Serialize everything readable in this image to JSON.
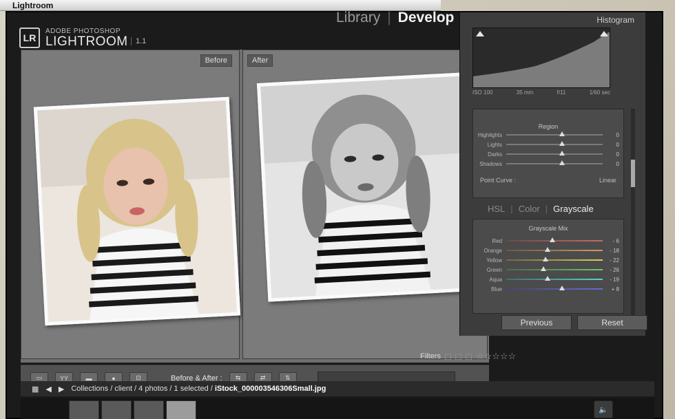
{
  "mac_menubar": {
    "app_name": "Lightroom"
  },
  "header": {
    "logo_mark": "LR",
    "brand_top": "ADOBE PHOTOSHOP",
    "brand_main": "LIGHTROOM",
    "version": "1.1",
    "modules": [
      {
        "label": "Library",
        "active": false
      },
      {
        "label": "Develop",
        "active": true
      }
    ]
  },
  "viewer": {
    "before_label": "Before",
    "after_label": "After"
  },
  "toolbar": {
    "before_after_label": "Before & After :",
    "view_buttons": [
      "loupe-view",
      "before-after-view",
      "compare",
      "spot",
      "crop"
    ],
    "filters_label": "Filters"
  },
  "right_panel": {
    "histogram_title": "Histogram",
    "histogram_meta": [
      "ISO 100",
      "35 mm",
      "f/11",
      "1/60 sec"
    ],
    "tone_section_title": "Region",
    "tone_sliders": [
      {
        "label": "Highlights",
        "value": 0,
        "position": 0.55
      },
      {
        "label": "Lights",
        "value": 0,
        "position": 0.55
      },
      {
        "label": "Darks",
        "value": 0,
        "position": 0.55
      },
      {
        "label": "Shadows",
        "value": 0,
        "position": 0.55
      }
    ],
    "point_curve_label": "Point Curve :",
    "point_curve_value": "Linear",
    "hsl_tabs": [
      "HSL",
      "Color",
      "Grayscale"
    ],
    "hsl_active": "Grayscale",
    "gray_mix_title": "Grayscale Mix",
    "gray_mix": [
      {
        "label": "Red",
        "value": "- 6",
        "position": 0.45
      },
      {
        "label": "Orange",
        "value": "- 18",
        "position": 0.4
      },
      {
        "label": "Yellow",
        "value": "- 22",
        "position": 0.38
      },
      {
        "label": "Green",
        "value": "- 26",
        "position": 0.36
      },
      {
        "label": "Aqua",
        "value": "- 19",
        "position": 0.4
      },
      {
        "label": "Blue",
        "value": "+ 8",
        "position": 0.55
      }
    ],
    "previous_button": "Previous",
    "reset_button": "Reset"
  },
  "breadcrumb": {
    "path": "Collections / client / 4 photos / 1 selected / ",
    "filename": "iStock_000003546306Small.jpg"
  },
  "filmstrip": {
    "thumbnails": [
      {
        "name": "thumb-1",
        "selected": false
      },
      {
        "name": "thumb-2",
        "selected": false
      },
      {
        "name": "thumb-3",
        "selected": false
      },
      {
        "name": "thumb-4",
        "selected": true
      }
    ]
  },
  "colors": {
    "panel_dark": "#1b1b1b",
    "viewer_gray": "#7b7b7b",
    "accent_white": "#f2f2f2"
  }
}
